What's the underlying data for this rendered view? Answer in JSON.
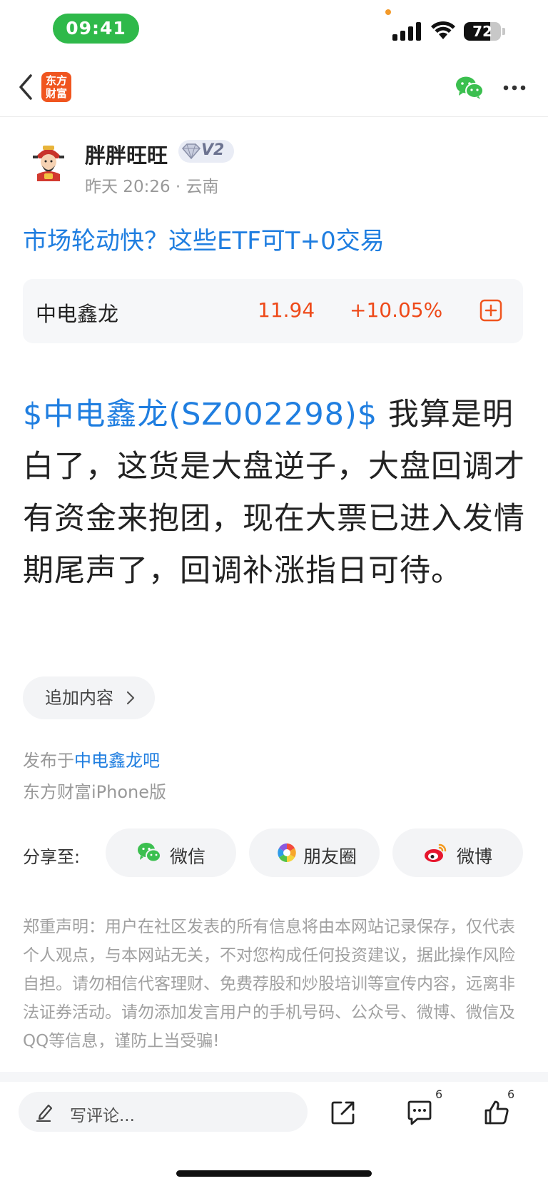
{
  "status_bar": {
    "time": "09:41",
    "battery_level": 72,
    "battery_label": "72"
  },
  "nav": {
    "logo_line1": "东方",
    "logo_line2": "财富"
  },
  "author": {
    "name": "胖胖旺旺",
    "level": "V2",
    "meta": "昨天 20:26 · 云南"
  },
  "post": {
    "title": "市场轮动快？这些ETF可T+0交易",
    "stock_card": {
      "name": "中电鑫龙",
      "price": "11.94",
      "change": "+10.05%"
    },
    "stock_link": "$中电鑫龙(SZ002298)$",
    "body_text": "  我算是明白了，这货是大盘逆子，大盘回调才有资金来抱团，现在大票已进入发情期尾声了，回调补涨指日可待。",
    "append_label": "追加内容",
    "published_prefix": "发布于",
    "forum_name": "中电鑫龙吧",
    "client": "东方财富iPhone版"
  },
  "share": {
    "label": "分享至:",
    "targets": [
      {
        "label": "微信",
        "icon": "wechat-icon"
      },
      {
        "label": "朋友圈",
        "icon": "moments-icon"
      },
      {
        "label": "微博",
        "icon": "weibo-icon"
      }
    ]
  },
  "disclaimer": "郑重声明：用户在社区发表的所有信息将由本网站记录保存，仅代表个人观点，与本网站无关，不对您构成任何投资建议，据此操作风险自担。请勿相信代客理财、免费荐股和炒股培训等宣传内容，远离非法证券活动。请勿添加发言用户的手机号码、公众号、微博、微信及QQ等信息，谨防上当受骗!",
  "bottom_bar": {
    "comment_placeholder": "写评论...",
    "comment_count": "6",
    "like_count": "6"
  },
  "colors": {
    "accent_blue": "#1f7ee0",
    "stock_red": "#ee4a1a",
    "wechat_green": "#2fb94a",
    "brand_orange": "#f0551f"
  }
}
